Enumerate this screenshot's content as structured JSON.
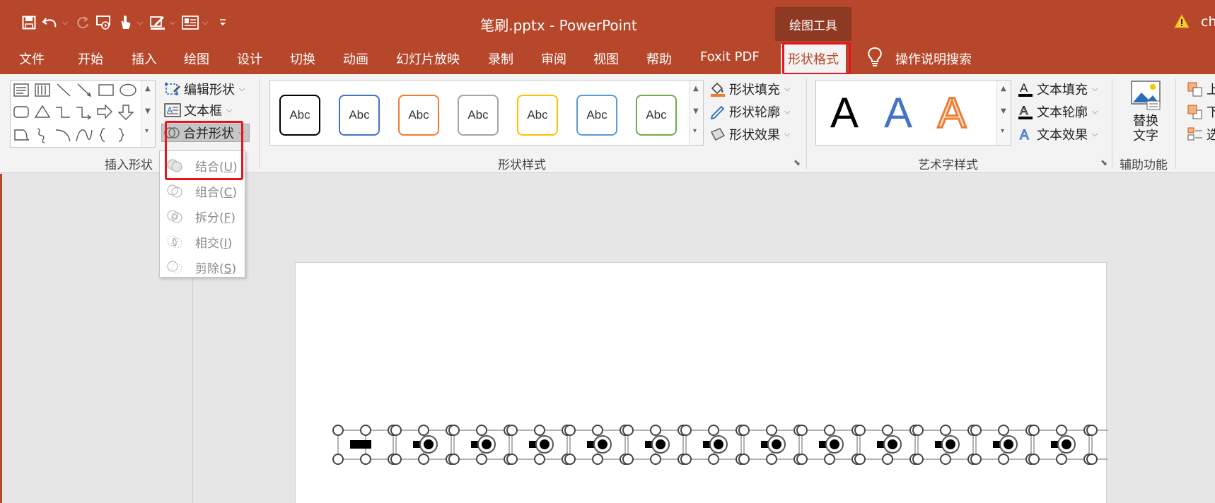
{
  "title_bar": {
    "document_title": "笔刷.pptx  -  PowerPoint",
    "context_tab_group": "绘图工具",
    "user_partial": "ch",
    "quick_access_icons": [
      "save-icon",
      "undo-icon",
      "redo-icon",
      "start-from-beginning-icon",
      "touch-mode-icon",
      "pen-icon",
      "textbox-icon",
      "customize-icon"
    ]
  },
  "tabs": [
    {
      "label": "文件"
    },
    {
      "label": "开始"
    },
    {
      "label": "插入"
    },
    {
      "label": "绘图"
    },
    {
      "label": "设计"
    },
    {
      "label": "切换"
    },
    {
      "label": "动画"
    },
    {
      "label": "幻灯片放映"
    },
    {
      "label": "录制"
    },
    {
      "label": "审阅"
    },
    {
      "label": "视图"
    },
    {
      "label": "帮助"
    },
    {
      "label": "Foxit PDF"
    },
    {
      "label": "形状格式",
      "active": true
    }
  ],
  "tell_me": "操作说明搜索",
  "ribbon": {
    "insert_shapes": {
      "label": "插入形状",
      "edit_shape": "编辑形状",
      "text_box": "文本框",
      "merge_shapes": "合并形状"
    },
    "shape_styles": {
      "label": "形状样式",
      "preset_text": "Abc",
      "preset_colors": [
        "#000000",
        "#4472c4",
        "#ed7d31",
        "#a5a5a5",
        "#ffc000",
        "#5b9bd5",
        "#70ad47"
      ],
      "fill": "形状填充",
      "outline": "形状轮廓",
      "effects": "形状效果"
    },
    "wordart_styles": {
      "label": "艺术字样式",
      "sample": "A",
      "text_fill": "文本填充",
      "text_outline": "文本轮廓",
      "text_effects": "文本效果"
    },
    "accessibility": {
      "label": "辅助功能",
      "alt_text_line1": "替换",
      "alt_text_line2": "文字"
    },
    "arrange_partial": {
      "bring_forward": "上",
      "send_backward": "下",
      "selection_pane": "选"
    }
  },
  "merge_menu": {
    "items": [
      {
        "label": "结合",
        "key": "U"
      },
      {
        "label": "组合",
        "key": "C"
      },
      {
        "label": "拆分",
        "key": "F"
      },
      {
        "label": "相交",
        "key": "I"
      },
      {
        "label": "剪除",
        "key": "S"
      }
    ]
  },
  "selection": {
    "object_count": 15
  },
  "colors": {
    "accent": "#b7472a",
    "highlight_box": "#e8141f"
  }
}
